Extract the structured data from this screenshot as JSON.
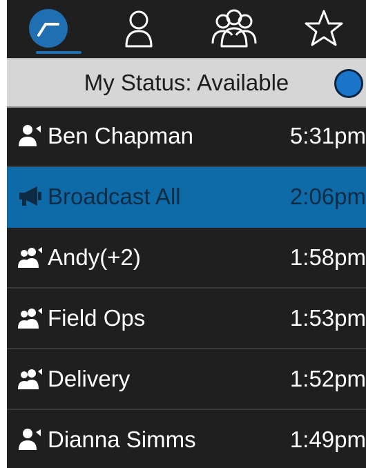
{
  "tabs": [
    {
      "id": "recents",
      "icon": "recent-calls-icon",
      "active": true
    },
    {
      "id": "contact",
      "icon": "single-contact-icon",
      "active": false
    },
    {
      "id": "groups",
      "icon": "groups-icon",
      "active": false
    },
    {
      "id": "favorites",
      "icon": "star-icon",
      "active": false
    }
  ],
  "status": {
    "text": "My Status: Available",
    "color": "#1a74c8"
  },
  "conversations": [
    {
      "name": "Ben Chapman",
      "time": "5:31pm",
      "icon": "person-talk-icon"
    },
    {
      "name": "Broadcast All",
      "time": "2:06pm",
      "icon": "megaphone-icon",
      "selected": true
    },
    {
      "name": "Andy(+2)",
      "time": "1:58pm",
      "icon": "group-talk-icon"
    },
    {
      "name": "Field Ops",
      "time": "1:53pm",
      "icon": "group-talk-icon"
    },
    {
      "name": "Delivery",
      "time": "1:52pm",
      "icon": "group-talk-icon"
    },
    {
      "name": "Dianna Simms",
      "time": "1:49pm",
      "icon": "person-talk-icon"
    }
  ],
  "colors": {
    "accent": "#1f6fb2",
    "selected_row": "#0f6aa8",
    "background": "#1f1f1f"
  }
}
